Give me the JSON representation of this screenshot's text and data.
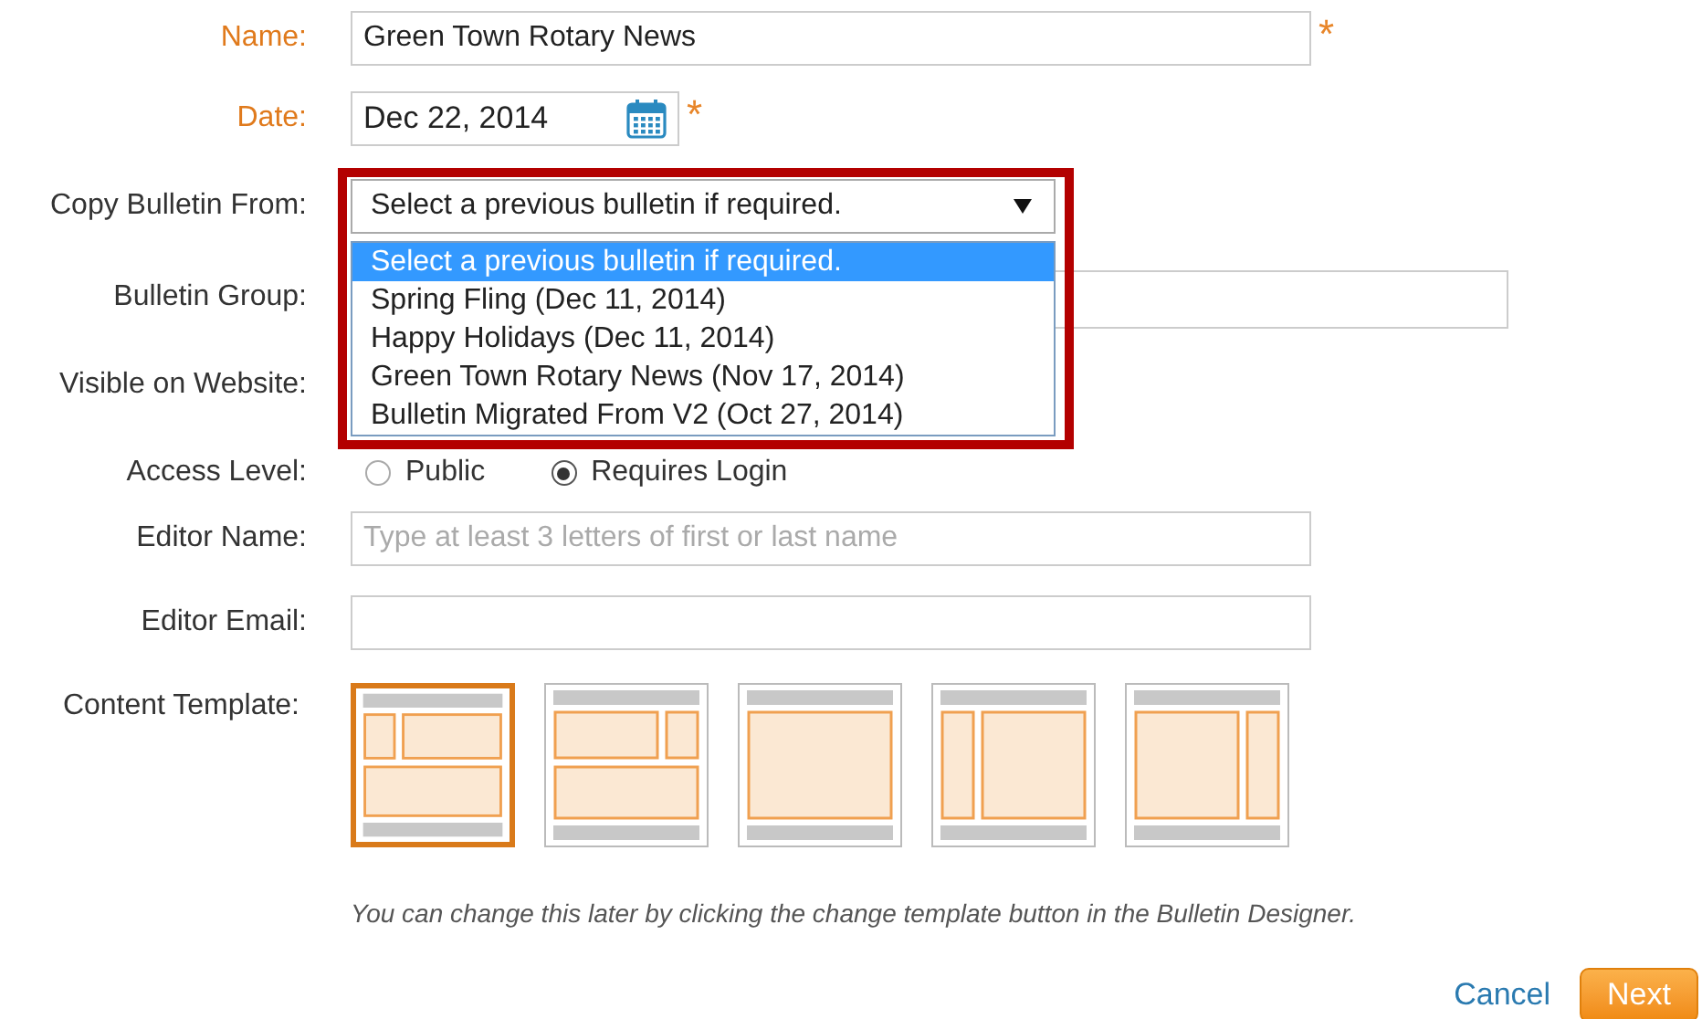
{
  "form": {
    "rows": [
      {
        "kind": "text",
        "label": "Name:",
        "required": true,
        "required_mark": "*",
        "value": "Green Town Rotary News"
      },
      {
        "kind": "date",
        "label": "Date:",
        "required": true,
        "required_mark": "*",
        "value": "Dec 22, 2014"
      },
      {
        "kind": "select",
        "label": "Copy Bulletin From:",
        "required": false,
        "value": "Select a previous bulletin if required.",
        "expanded": true,
        "highlighted": true,
        "options": [
          {
            "label": "Select a previous bulletin if required.",
            "selected": true
          },
          {
            "label": "Spring Fling (Dec 11, 2014)",
            "selected": false
          },
          {
            "label": "Happy Holidays (Dec 11, 2014)",
            "selected": false
          },
          {
            "label": "Green Town Rotary News (Nov 17, 2014)",
            "selected": false
          },
          {
            "label": "Bulletin Migrated From V2 (Oct 27, 2014)",
            "selected": false
          }
        ]
      },
      {
        "kind": "wide",
        "label": "Bulletin Group:",
        "required": false
      },
      {
        "kind": "covered",
        "label": "Visible on Website:",
        "required": false
      },
      {
        "kind": "radio",
        "label": "Access Level:",
        "required": false,
        "options": [
          {
            "label": "Public",
            "selected": false
          },
          {
            "label": "Requires Login",
            "selected": true
          }
        ]
      },
      {
        "kind": "text",
        "label": "Editor Name:",
        "required": false,
        "placeholder": "Type at least 3 letters of first or last name"
      },
      {
        "kind": "text",
        "label": "Editor Email:",
        "required": false
      },
      {
        "kind": "template",
        "label": "Content Template:",
        "required": false,
        "templates": [
          {
            "kind": "split-top-left",
            "selected": true
          },
          {
            "kind": "split-top-right",
            "selected": false
          },
          {
            "kind": "single",
            "selected": false
          },
          {
            "kind": "sidebar-left",
            "selected": false
          },
          {
            "kind": "sidebar-right",
            "selected": false
          }
        ]
      }
    ],
    "note": "You can change this later by clicking the change template button in the Bulletin Designer.",
    "buttons": [
      {
        "kind": "link",
        "label": "Cancel"
      },
      {
        "kind": "primary",
        "label": "Next"
      }
    ]
  }
}
